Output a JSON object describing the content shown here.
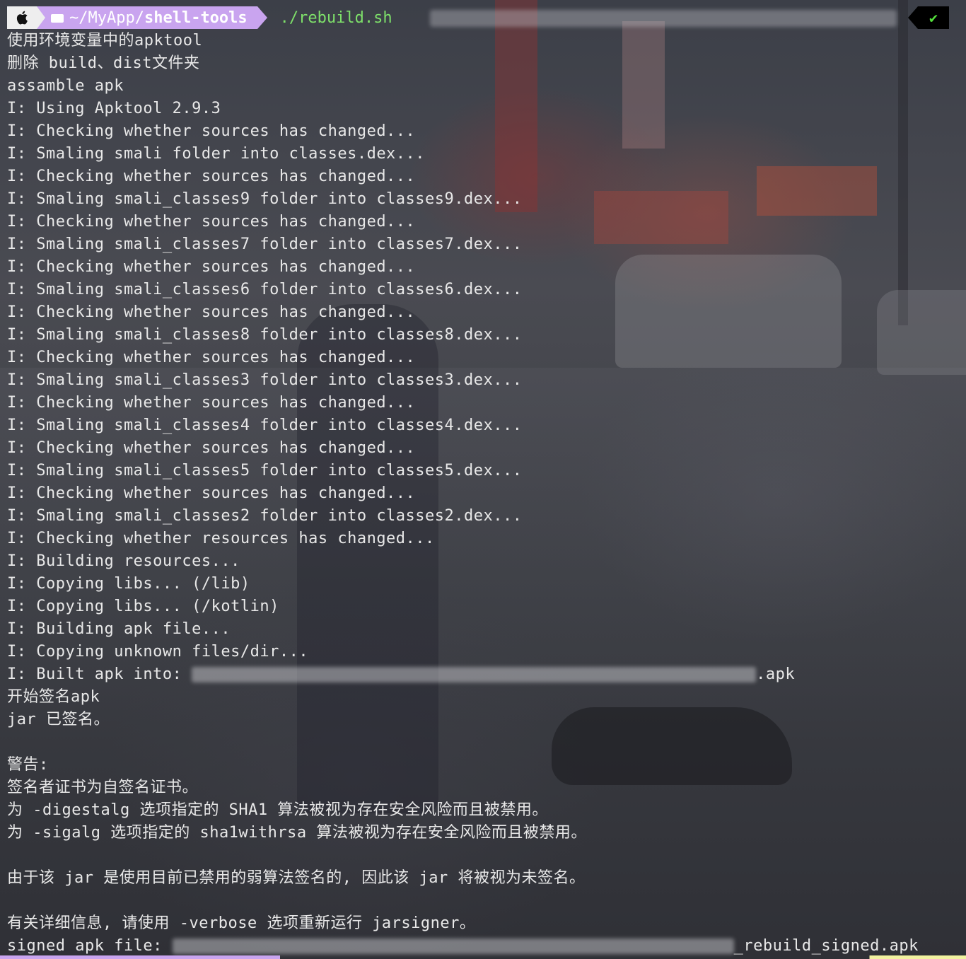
{
  "prompt": {
    "apple_icon": "apple-logo",
    "path_prefix": "~/MyApp/",
    "path_dir": "shell-tools",
    "command": "./rebuild.sh",
    "status_mark": "✔"
  },
  "colors": {
    "path_segment": "#c9a4ef",
    "command": "#7ee06a",
    "status_ok": "#54e13c"
  },
  "output_lines": [
    "使用环境变量中的apktool",
    "删除 build、dist文件夹",
    "assamble apk",
    "I: Using Apktool 2.9.3",
    "I: Checking whether sources has changed...",
    "I: Smaling smali folder into classes.dex...",
    "I: Checking whether sources has changed...",
    "I: Smaling smali_classes9 folder into classes9.dex...",
    "I: Checking whether sources has changed...",
    "I: Smaling smali_classes7 folder into classes7.dex...",
    "I: Checking whether sources has changed...",
    "I: Smaling smali_classes6 folder into classes6.dex...",
    "I: Checking whether sources has changed...",
    "I: Smaling smali_classes8 folder into classes8.dex...",
    "I: Checking whether sources has changed...",
    "I: Smaling smali_classes3 folder into classes3.dex...",
    "I: Checking whether sources has changed...",
    "I: Smaling smali_classes4 folder into classes4.dex...",
    "I: Checking whether sources has changed...",
    "I: Smaling smali_classes5 folder into classes5.dex...",
    "I: Checking whether sources has changed...",
    "I: Smaling smali_classes2 folder into classes2.dex...",
    "I: Checking whether resources has changed...",
    "I: Building resources...",
    "I: Copying libs... (/lib)",
    "I: Copying libs... (/kotlin)",
    "I: Building apk file...",
    "I: Copying unknown files/dir..."
  ],
  "built_line": {
    "prefix": "I: Built apk into: ",
    "suffix": ".apk"
  },
  "after_built_lines": [
    "开始签名apk",
    "jar 已签名。",
    "",
    "警告:",
    "签名者证书为自签名证书。",
    "为 -digestalg 选项指定的 SHA1 算法被视为存在安全风险而且被禁用。",
    "为 -sigalg 选项指定的 sha1withrsa 算法被视为存在安全风险而且被禁用。",
    "",
    "由于该 jar 是使用目前已禁用的弱算法签名的, 因此该 jar 将被视为未签名。",
    "",
    "有关详细信息, 请使用 -verbose 选项重新运行 jarsigner。"
  ],
  "signed_line": {
    "prefix": "signed apk file: ",
    "suffix": "_rebuild_signed.apk"
  }
}
